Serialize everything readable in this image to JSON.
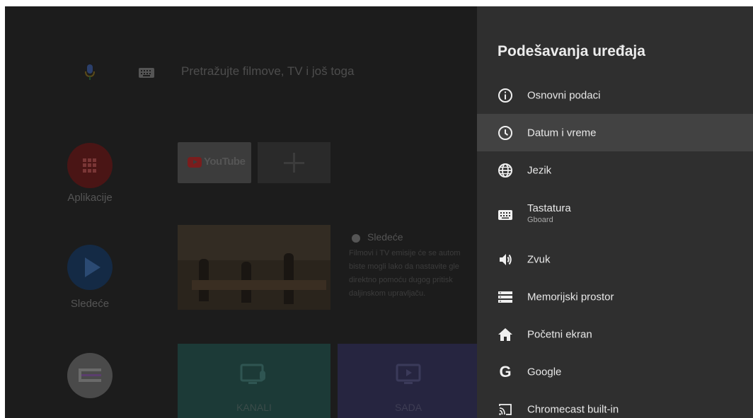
{
  "home": {
    "search_placeholder": "Pretražujte filmove, TV i još toga",
    "apps_label": "Aplikacije",
    "next_label": "Sledeće",
    "youtube_label": "YouTube",
    "next_card": {
      "title": "Sledeće",
      "description_lines": [
        "Filmovi i TV emisije će se autom",
        "biste mogli lako da nastavite gle",
        "direktno pomoću dugog pritisk",
        "daljinskom upravljaču."
      ]
    },
    "tiles": {
      "kanali": "KANALI",
      "sada": "SADA"
    },
    "colors": {
      "apps": "#4a1515",
      "next": "#142a45",
      "kanali": "#1c3a37",
      "sada": "#262540"
    }
  },
  "settings": {
    "title": "Podešavanja uređaja",
    "items": [
      {
        "label": "Osnovni podaci",
        "icon": "info-icon"
      },
      {
        "label": "Datum i vreme",
        "icon": "clock-icon",
        "selected": true
      },
      {
        "label": "Jezik",
        "icon": "globe-icon"
      },
      {
        "label": "Tastatura",
        "sublabel": "Gboard",
        "icon": "keyboard-icon"
      },
      {
        "label": "Zvuk",
        "icon": "volume-icon"
      },
      {
        "label": "Memorijski prostor",
        "icon": "storage-icon"
      },
      {
        "label": "Početni ekran",
        "icon": "home-icon"
      },
      {
        "label": "Google",
        "icon": "google-icon"
      },
      {
        "label": "Chromecast built-in",
        "icon": "cast-icon"
      }
    ]
  }
}
